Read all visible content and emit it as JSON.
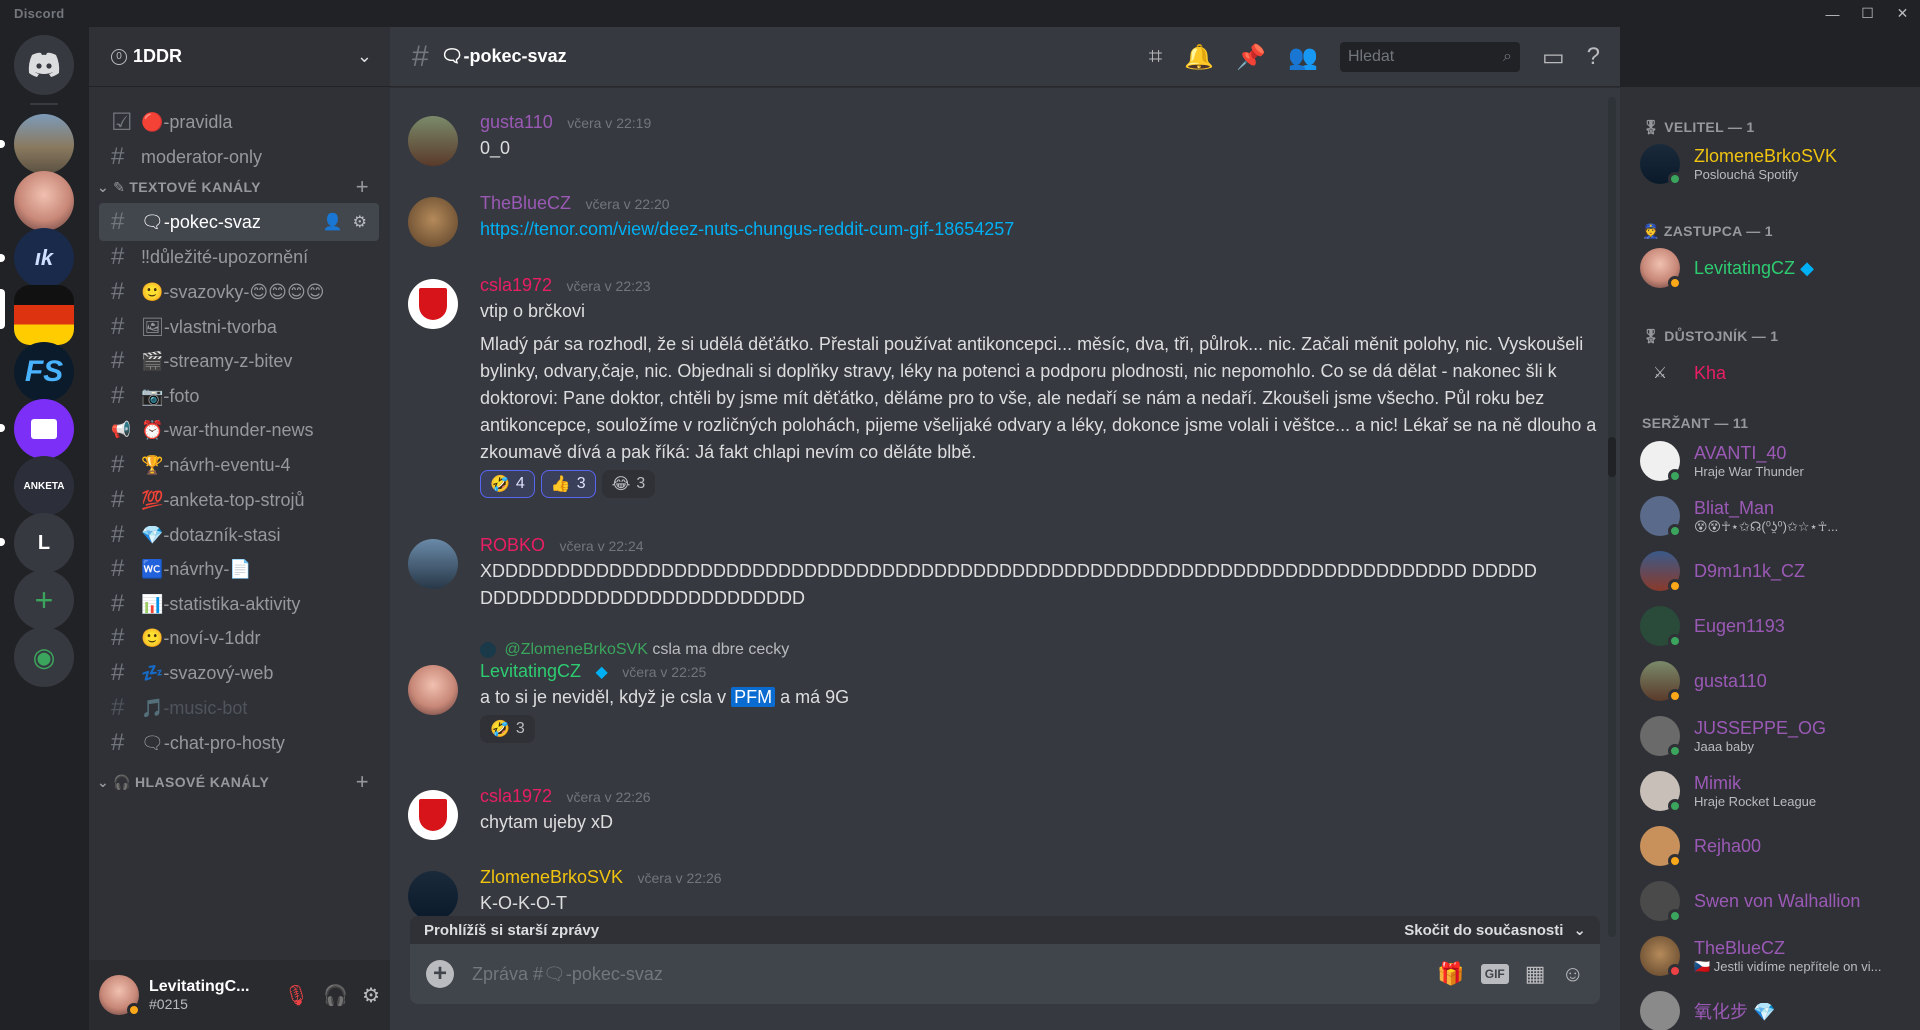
{
  "app": {
    "title": "Discord"
  },
  "guild": {
    "name": "1DDR",
    "boost_glyph": "0"
  },
  "server_rail": [
    {
      "name": "Direct Messages"
    },
    {
      "name": "server-1"
    },
    {
      "name": "server-2"
    },
    {
      "name": "server-3"
    },
    {
      "name": "server-4"
    },
    {
      "name": "FS"
    },
    {
      "name": "server-6"
    },
    {
      "name": "Anketa Bot"
    },
    {
      "name": "L"
    }
  ],
  "sidebar": {
    "top_channels": [
      {
        "icon": "☑",
        "label": "🔴-pravidla"
      },
      {
        "icon": "#",
        "label": "moderator-only"
      }
    ],
    "text_category": "TEXTOVÉ KANÁLY",
    "voice_category": "HLASOVÉ KANÁLY",
    "channels": [
      {
        "label": "🗨-pokec-svaz",
        "active": true
      },
      {
        "label": "‼důležité-upozornění"
      },
      {
        "label": "🙂-svazovky-😊😊😊😊"
      },
      {
        "label": "🖼-vlastni-tvorba"
      },
      {
        "label": "🎬-streamy-z-bitev"
      },
      {
        "label": "📷-foto"
      },
      {
        "label": "⏰-war-thunder-news",
        "icon": "📢"
      },
      {
        "label": "🏆-návrh-eventu-4"
      },
      {
        "label": "💯-anketa-top-strojů"
      },
      {
        "label": "💎-dotazník-stasi"
      },
      {
        "label": "🚾-návrhy-📄"
      },
      {
        "label": "📊-statistika-aktivity"
      },
      {
        "label": "🙂-noví-v-1ddr"
      },
      {
        "label": "💤-svazový-web"
      },
      {
        "label": "🎵-music-bot",
        "muted": true
      },
      {
        "label": "🗨-chat-pro-hosty"
      }
    ]
  },
  "user_panel": {
    "name": "LevitatingC...",
    "tag": "#0215"
  },
  "header": {
    "channel_name": "🗨-pokec-svaz",
    "search_placeholder": "Hledat"
  },
  "messages": [
    {
      "author": "gusta110",
      "color": "#9b59b6",
      "time": "včera v 22:19",
      "lines": [
        "0_0"
      ]
    },
    {
      "author": "TheBlueCZ",
      "color": "#9b59b6",
      "time": "včera v 22:20",
      "link": "https://tenor.com/view/deez-nuts-chungus-reddit-cum-gif-18654257"
    },
    {
      "author": "csla1972",
      "color": "#e91e63",
      "time": "včera v 22:23",
      "lines": [
        "vtip o brčkovi",
        "Mladý pár sa rozhodl, že si udělá děťátko. Přestali používat antikoncepci... měsíc, dva, tři, půlrok... nic. Začali měnit polohy, nic. Vyskoušeli bylinky, odvary,čaje, nic. Objednali si doplňky stravy, léky na potenci a podporu plodnosti, nic nepomohlo. Co se dá dělat - nakonec šli k doktorovi: Pane doktor, chtěli by jsme mít děťátko, děláme pro to vše, ale nedaří se nám a nedaří. Zkoušeli jsme všecho. Půl roku bez antikoncepce, souložíme v rozličných polohách, pijeme všelijaké odvary a léky, dokonce jsme volali i věštce... a nic! Lékař se na ně dlouho a zkoumavě dívá a pak říká: Já fakt chlapi nevím co děláte blbě."
      ],
      "reactions": [
        {
          "emoji": "🤣",
          "count": "4",
          "me": true
        },
        {
          "emoji": "👍",
          "count": "3",
          "me": true
        },
        {
          "emoji": "😂",
          "count": "3",
          "me": false
        }
      ]
    },
    {
      "author": "ROBKO",
      "color": "#e91e63",
      "time": "včera v 22:24",
      "lines": [
        "XDDDDDDDDDDDDDDDDDDDDDDDDDDDDDDDDDDDDDDDDDDDDDDDDDDDDDDDDDDDDDDDDDDDDDDDDDDD DDDDDDDDDDDDDDDDDDDDDDDDDDDDDD"
      ]
    },
    {
      "author": "LevitatingCZ",
      "color": "#2ecc71",
      "time": "včera v 22:25",
      "reply": {
        "mention": "@ZlomeneBrkoSVK",
        "text": "csla ma dbre cecky"
      },
      "text_before": "a to si je neviděl, když je csla v ",
      "highlight": "PFM",
      "text_after": " a má 9G",
      "reactions": [
        {
          "emoji": "🤣",
          "count": "3",
          "me": false
        }
      ]
    },
    {
      "author": "csla1972",
      "color": "#e91e63",
      "time": "včera v 22:26",
      "lines": [
        "chytam ujeby xD"
      ]
    },
    {
      "author": "ZlomeneBrkoSVK",
      "color": "#f1c40f",
      "time": "včera v 22:26",
      "lines": [
        "K-O-K-O-T"
      ]
    }
  ],
  "older_bar": {
    "left": "Prohlížíš si starší zprávy",
    "right": "Skočit do současnosti"
  },
  "composer": {
    "placeholder": "Zpráva #🗨-pokec-svaz",
    "gif": "GIF"
  },
  "members": {
    "categories": [
      {
        "label": "🎖 VELITEL — 1"
      },
      {
        "label": "👮 ZASTUPCA — 1"
      },
      {
        "label": "🎖 DŮSTOJNÍK — 1"
      },
      {
        "label": "SERŽANT — 11"
      }
    ],
    "list": [
      {
        "name": "ZlomeneBrkoSVK",
        "color": "#f1c40f",
        "activity": "Poslouchá Spotify",
        "status": "#3ba55d"
      },
      {
        "name": "LevitatingCZ",
        "color": "#2ecc71",
        "activity": "",
        "status": "#faa81a"
      },
      {
        "name": "Kha",
        "color": "#e91e63",
        "activity": "",
        "status": ""
      },
      {
        "name": "AVANTI_40",
        "color": "#9b59b6",
        "activity": "Hraje War Thunder",
        "status": "#3ba55d"
      },
      {
        "name": "Bliat_Man",
        "color": "#9b59b6",
        "activity": "😵😵☥⋆✩☊(⁰ʖ̯⁰)✩☆⋆☥...",
        "status": "#3ba55d"
      },
      {
        "name": "D9m1n1k_CZ",
        "color": "#9b59b6",
        "activity": "",
        "status": "#faa81a"
      },
      {
        "name": "Eugen1193",
        "color": "#9b59b6",
        "activity": "",
        "status": "#3ba55d"
      },
      {
        "name": "gusta110",
        "color": "#9b59b6",
        "activity": "",
        "status": "#faa81a"
      },
      {
        "name": "JUSSEPPE_OG",
        "color": "#9b59b6",
        "activity": "Jaaa baby",
        "status": "#3ba55d"
      },
      {
        "name": "Mimik",
        "color": "#9b59b6",
        "activity": "Hraje Rocket League",
        "status": "#3ba55d"
      },
      {
        "name": "Rejha00",
        "color": "#9b59b6",
        "activity": "",
        "status": "#faa81a"
      },
      {
        "name": "Swen von Walhallion",
        "color": "#9b59b6",
        "activity": "",
        "status": "#3ba55d"
      },
      {
        "name": "TheBlueCZ",
        "color": "#9b59b6",
        "activity": "🇨🇿 Jestli vidíme nepřítele on vi...",
        "status": "#ed4245"
      },
      {
        "name": "氧化步 💎",
        "color": "#9b59b6",
        "activity": "",
        "status": ""
      }
    ]
  },
  "colors": {
    "bg_main": "#36393f",
    "bg_sidebar": "#2f3136",
    "bg_rail": "#202225",
    "accent": "#5865f2",
    "link": "#00b0f4"
  }
}
